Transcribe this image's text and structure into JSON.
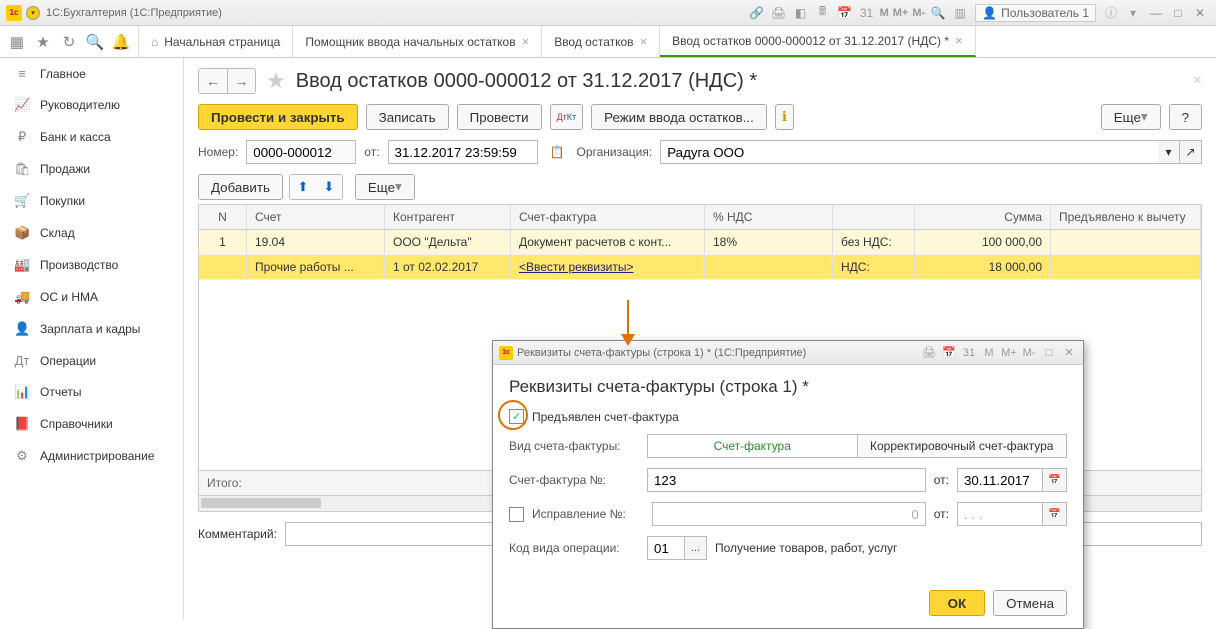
{
  "titlebar": {
    "app_title": "1С:Бухгалтерия  (1С:Предприятие)",
    "user_label": "Пользователь 1"
  },
  "toprow": {
    "tabs": [
      {
        "label": "Начальная страница",
        "home": true
      },
      {
        "label": "Помощник ввода начальных остатков",
        "closable": true
      },
      {
        "label": "Ввод остатков",
        "closable": true
      },
      {
        "label": "Ввод остатков 0000-000012 от 31.12.2017 (НДС) *",
        "closable": true,
        "active": true
      }
    ]
  },
  "sidebar": {
    "items": [
      {
        "icon": "≡",
        "label": "Главное"
      },
      {
        "icon": "📈",
        "label": "Руководителю"
      },
      {
        "icon": "₽",
        "label": "Банк и касса"
      },
      {
        "icon": "🛍",
        "label": "Продажи"
      },
      {
        "icon": "🛒",
        "label": "Покупки"
      },
      {
        "icon": "📦",
        "label": "Склад"
      },
      {
        "icon": "🏭",
        "label": "Производство"
      },
      {
        "icon": "🚚",
        "label": "ОС и НМА"
      },
      {
        "icon": "👤",
        "label": "Зарплата и кадры"
      },
      {
        "icon": "Дт",
        "label": "Операции"
      },
      {
        "icon": "📊",
        "label": "Отчеты"
      },
      {
        "icon": "📕",
        "label": "Справочники"
      },
      {
        "icon": "⚙",
        "label": "Администрирование"
      }
    ]
  },
  "page": {
    "title": "Ввод остатков 0000-000012 от 31.12.2017 (НДС) *",
    "buttons": {
      "post_close": "Провести и закрыть",
      "save": "Записать",
      "post": "Провести",
      "mode": "Режим ввода остатков...",
      "more": "Еще",
      "help": "?"
    },
    "fields": {
      "number_label": "Номер:",
      "number": "0000-000012",
      "from_label": "от:",
      "date": "31.12.2017 23:59:59",
      "org_label": "Организация:",
      "org": "Радуга ООО"
    },
    "table_toolbar": {
      "add": "Добавить",
      "more": "Еще"
    },
    "table": {
      "headers": {
        "n": "N",
        "acc": "Счет",
        "ctr": "Контрагент",
        "inv": "Счет-фактура",
        "vat": "% НДС",
        "lbl": "",
        "sum": "Сумма",
        "ded": "Предъявлено к вычету"
      },
      "rows": [
        {
          "n": "1",
          "acc": "19.04",
          "ctr": "ООО \"Дельта\"",
          "inv": "Документ расчетов с конт...",
          "vat": "18%",
          "lbl": "без НДС:",
          "sum": "100 000,00",
          "ded": ""
        },
        {
          "n": "",
          "acc": "Прочие работы ...",
          "ctr": "1 от 02.02.2017",
          "inv": "<Ввести реквизиты>",
          "vat": "",
          "lbl": "НДС:",
          "sum": "18 000,00",
          "ded": ""
        }
      ],
      "total_label": "Итого:"
    },
    "comment_label": "Комментарий:",
    "comment": ""
  },
  "modal": {
    "window_title": "Реквизиты счета-фактуры (строка 1) *  (1С:Предприятие)",
    "title": "Реквизиты счета-фактуры (строка 1) *",
    "presented_chk": true,
    "presented_label": "Предъявлен счет-фактура",
    "invoice_type_label": "Вид счета-фактуры:",
    "invoice_type_options": [
      "Счет-фактура",
      "Корректировочный счет-фактура"
    ],
    "invoice_no_label": "Счет-фактура №:",
    "invoice_no": "123",
    "from_label": "от:",
    "invoice_date": "30.11.2017",
    "corr_chk": false,
    "corr_label": "Исправление №:",
    "corr_no": "0",
    "corr_from_label": "от:",
    "corr_date": ". . .",
    "op_code_label": "Код вида операции:",
    "op_code": "01",
    "op_code_desc": "Получение товаров, работ, услуг",
    "ok": "ОК",
    "cancel": "Отмена"
  }
}
